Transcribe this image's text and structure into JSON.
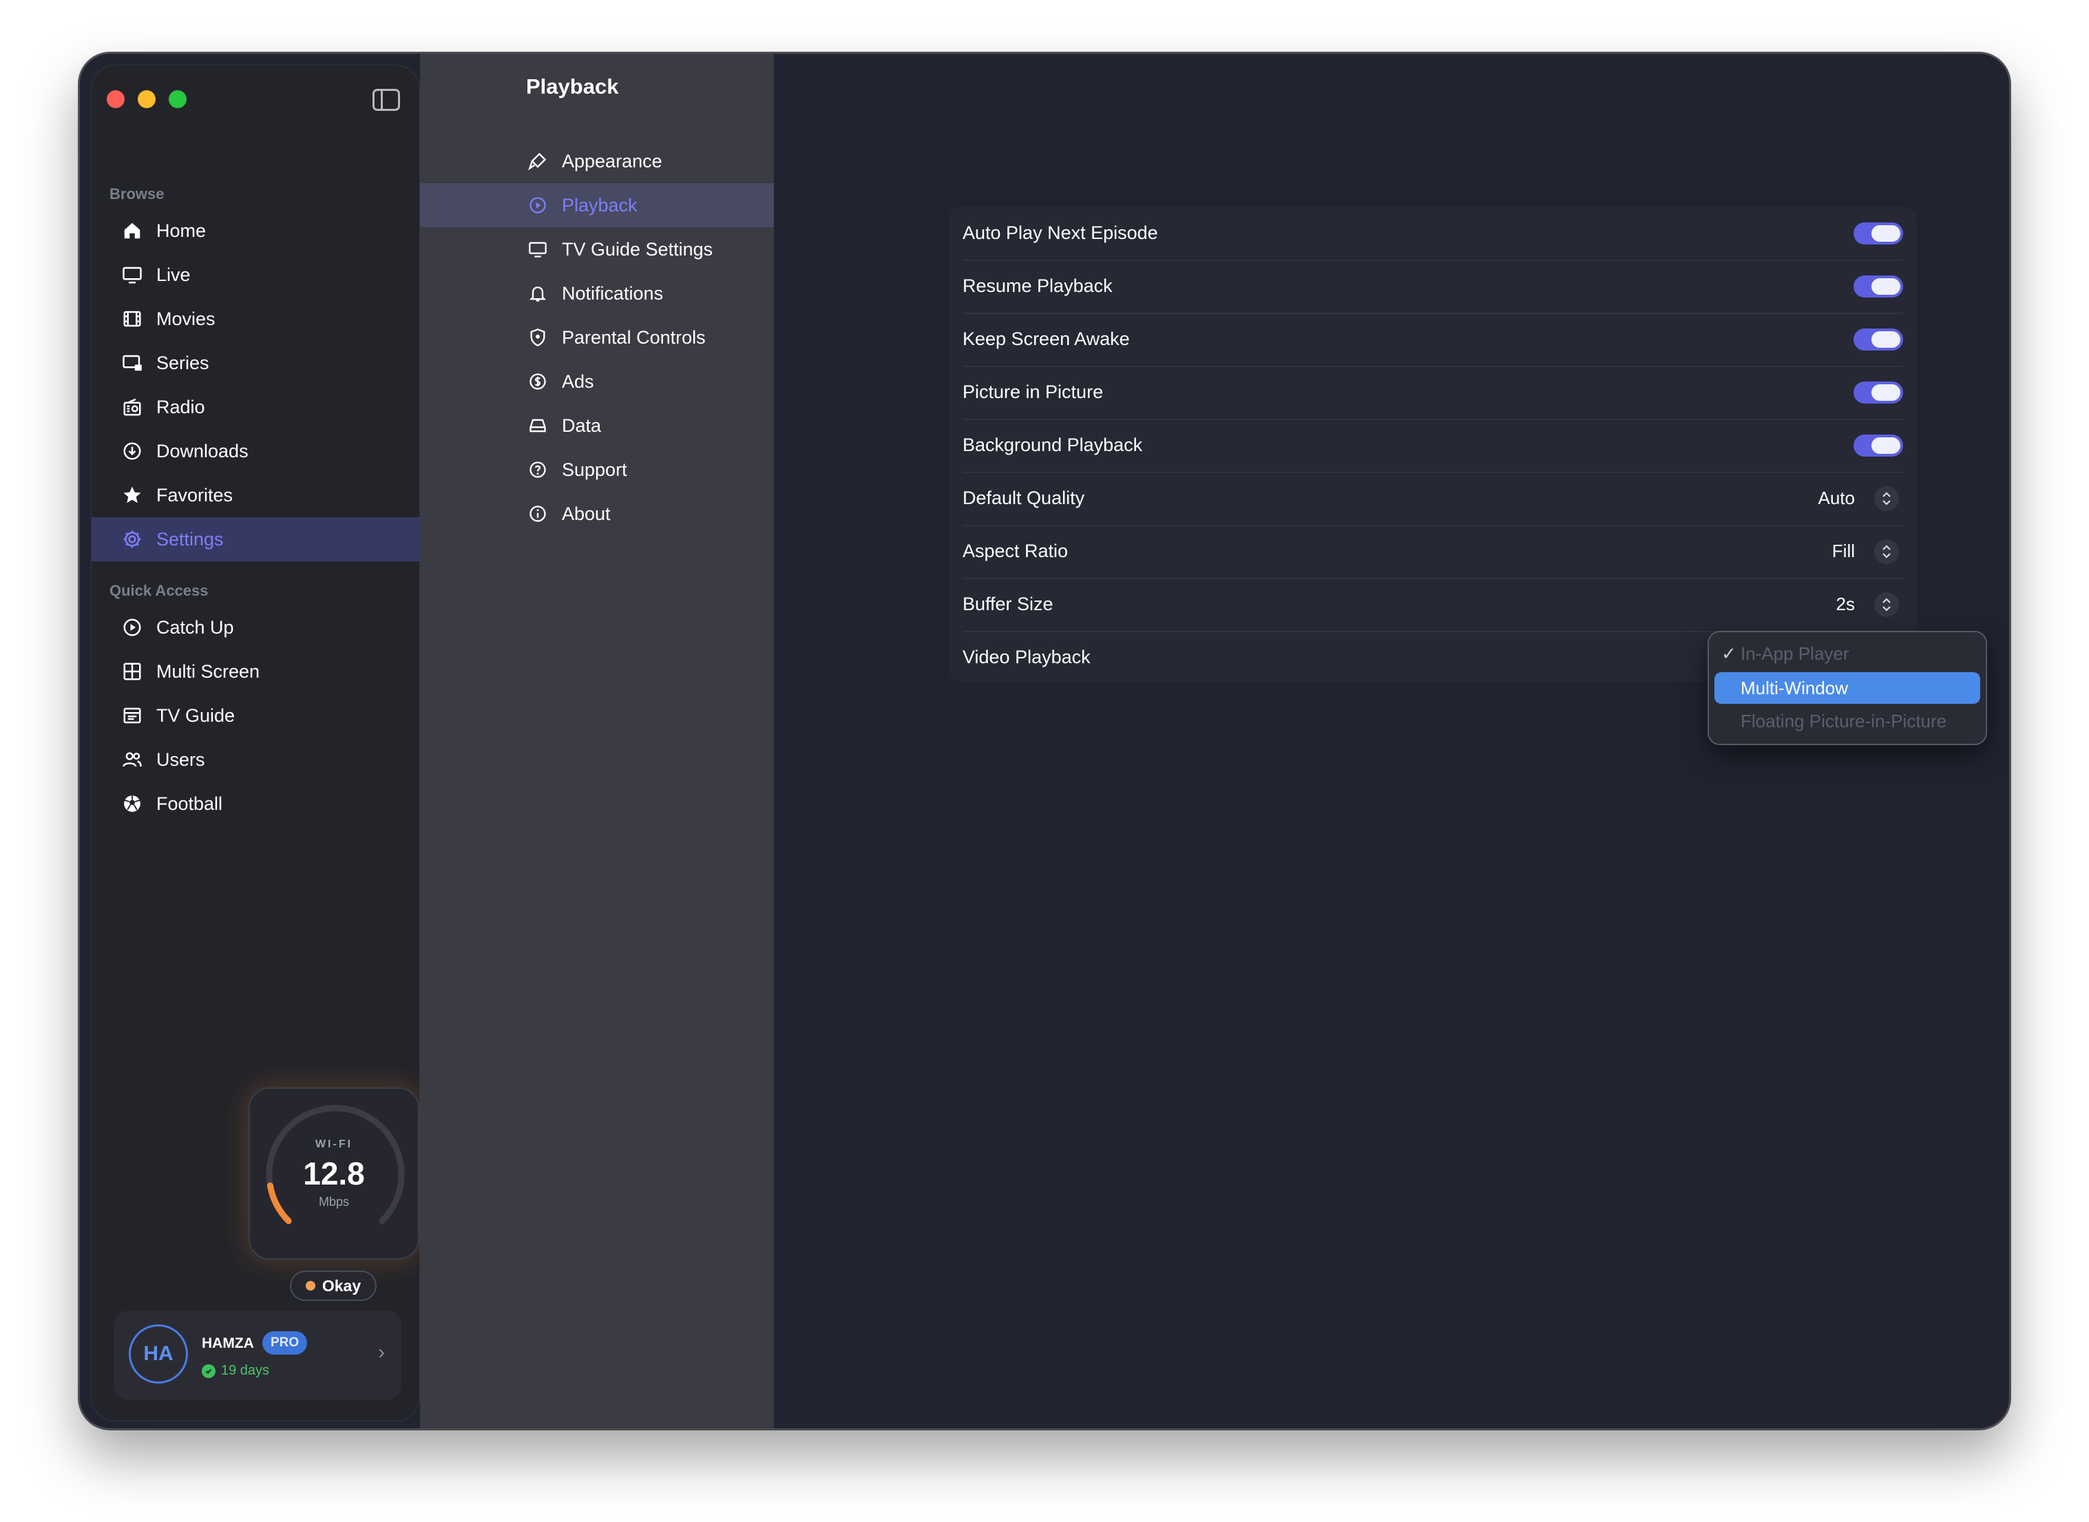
{
  "sidebar": {
    "section_browse": "Browse",
    "browse_items": [
      {
        "label": "Home",
        "icon": "home-icon"
      },
      {
        "label": "Live",
        "icon": "tv-icon"
      },
      {
        "label": "Movies",
        "icon": "film-icon"
      },
      {
        "label": "Series",
        "icon": "series-icon"
      },
      {
        "label": "Radio",
        "icon": "radio-icon"
      },
      {
        "label": "Downloads",
        "icon": "download-icon"
      },
      {
        "label": "Favorites",
        "icon": "star-icon"
      },
      {
        "label": "Settings",
        "icon": "gear-icon",
        "active": true
      }
    ],
    "section_quick": "Quick Access",
    "quick_items": [
      {
        "label": "Catch Up",
        "icon": "play-circle-icon"
      },
      {
        "label": "Multi Screen",
        "icon": "grid-icon"
      },
      {
        "label": "TV Guide",
        "icon": "calendar-icon"
      },
      {
        "label": "Users",
        "icon": "users-icon"
      },
      {
        "label": "Football",
        "icon": "football-icon"
      }
    ],
    "speed": {
      "label": "WI-FI",
      "value": "12.8",
      "unit": "Mbps",
      "status": "Okay",
      "gauge_fraction": 0.13
    },
    "user": {
      "initials": "HA",
      "name": "HAMZA",
      "badge": "PRO",
      "days": "19 days"
    }
  },
  "settings_nav": {
    "title": "Playback",
    "items": [
      {
        "label": "Appearance",
        "icon": "brush-icon"
      },
      {
        "label": "Playback",
        "icon": "play-circle-icon",
        "active": true
      },
      {
        "label": "TV Guide Settings",
        "icon": "monitor-icon"
      },
      {
        "label": "Notifications",
        "icon": "bell-icon"
      },
      {
        "label": "Parental Controls",
        "icon": "shield-icon"
      },
      {
        "label": "Ads",
        "icon": "dollar-icon"
      },
      {
        "label": "Data",
        "icon": "drive-icon"
      },
      {
        "label": "Support",
        "icon": "help-icon"
      },
      {
        "label": "About",
        "icon": "info-icon"
      }
    ]
  },
  "playback": {
    "rows": [
      {
        "label": "Auto Play Next Episode",
        "type": "toggle",
        "value": true
      },
      {
        "label": "Resume Playback",
        "type": "toggle",
        "value": true
      },
      {
        "label": "Keep Screen Awake",
        "type": "toggle",
        "value": true
      },
      {
        "label": "Picture in Picture",
        "type": "toggle",
        "value": true
      },
      {
        "label": "Background Playback",
        "type": "toggle",
        "value": true
      },
      {
        "label": "Default Quality",
        "type": "select",
        "value": "Auto"
      },
      {
        "label": "Aspect Ratio",
        "type": "select",
        "value": "Fill"
      },
      {
        "label": "Buffer Size",
        "type": "select",
        "value": "2s"
      },
      {
        "label": "Video Playback",
        "type": "select",
        "value": "In-App Player"
      }
    ],
    "video_playback_menu": {
      "options": [
        "In-App Player",
        "Multi-Window",
        "Floating Picture-in-Picture"
      ],
      "checked": "In-App Player",
      "highlighted": "Multi-Window",
      "check_glyph": "✓"
    }
  },
  "colors": {
    "accent": "#5d5fe0",
    "active_text": "#7c7ff6",
    "highlight": "#4a8ae8",
    "window_bg": "#212330"
  }
}
